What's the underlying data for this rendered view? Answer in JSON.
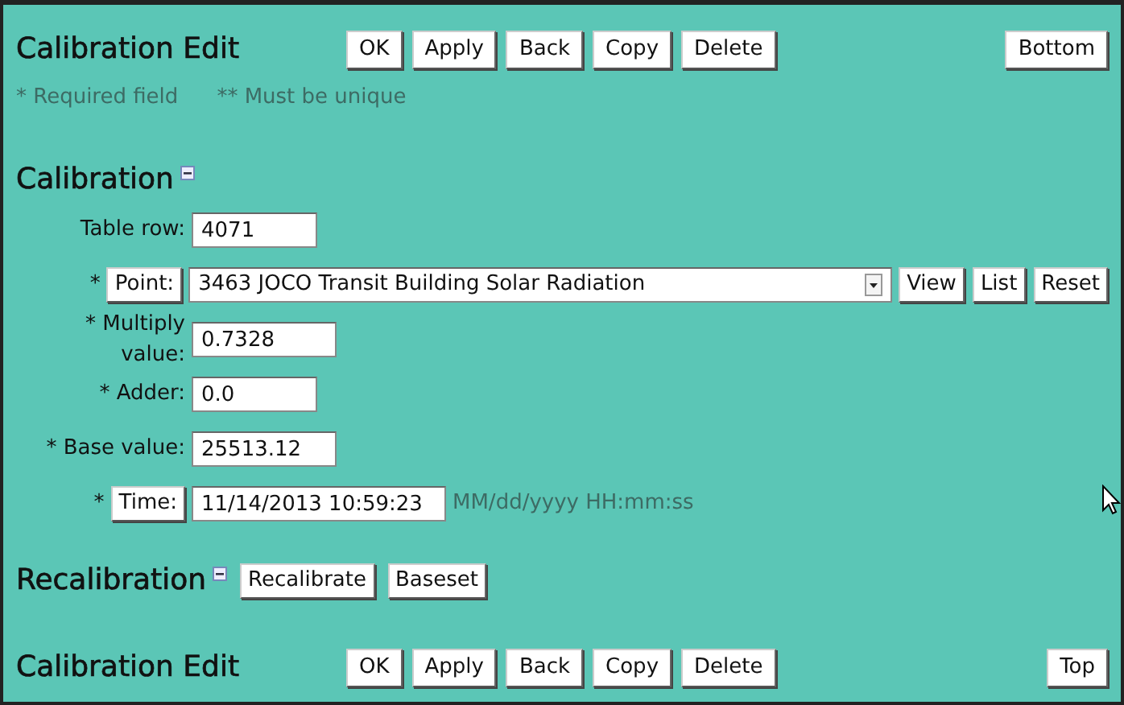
{
  "header": {
    "title": "Calibration Edit",
    "buttons": [
      "OK",
      "Apply",
      "Back",
      "Copy",
      "Delete"
    ],
    "nav_button": "Bottom"
  },
  "notes": [
    "* Required field",
    "** Must be unique"
  ],
  "calibration": {
    "title": "Calibration",
    "expanded": true,
    "fields": [
      {
        "kind": "text",
        "label": "Table row:",
        "value": "4071"
      },
      {
        "kind": "lookup",
        "marker": "*",
        "button": "Point:",
        "value": "3463 JOCO Transit Building Solar Radiation",
        "actions": [
          "View",
          "List",
          "Reset"
        ]
      },
      {
        "kind": "text",
        "label": "* Multiply value:",
        "value": "0.7328"
      },
      {
        "kind": "text",
        "label": "* Adder:",
        "value": "0.0"
      },
      {
        "kind": "text",
        "label": "* Base value:",
        "value": "25513.12"
      },
      {
        "kind": "time",
        "marker": "*",
        "button": "Time:",
        "value": "11/14/2013 10:59:23",
        "hint": "MM/dd/yyyy HH:mm:ss"
      }
    ]
  },
  "recalibration": {
    "title": "Recalibration",
    "expanded": true,
    "buttons": [
      "Recalibrate",
      "Baseset"
    ]
  },
  "footer": {
    "title": "Calibration Edit",
    "buttons": [
      "OK",
      "Apply",
      "Back",
      "Copy",
      "Delete"
    ],
    "nav_button": "Top"
  }
}
